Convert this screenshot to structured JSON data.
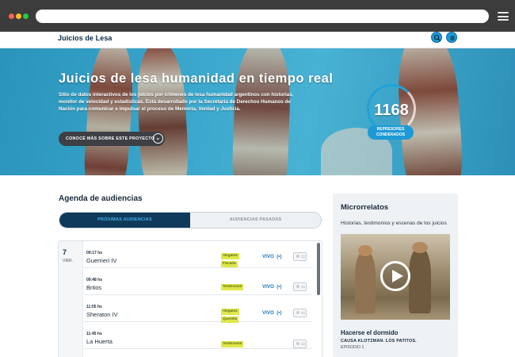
{
  "site": {
    "brand": "Juicios de Lesa"
  },
  "hero": {
    "title": "Juicios de lesa humanidad en tiempo real",
    "description": "Sitio de datos interactivos de los juicios por crímenes de lesa humanidad argentinos con historias, monitor de velocidad y estadísticas. Está desarrollado por la Secretaría de Derechos Humanos de Nación para comunicar e impulsar el proceso de Memoria, Verdad y Justicia.",
    "cta_label": "CONOCÉ MÁS SOBRE ESTE PROYECTO",
    "counter_value": "1168",
    "counter_label_line1": "REPRESORES",
    "counter_label_line2": "CONDENADOS"
  },
  "agenda": {
    "title": "Agenda de audiencias",
    "tabs": [
      "PRÓXIMAS AUDIENCIAS",
      "AUDIENCIAS PASADAS"
    ],
    "day_number": "7",
    "day_name": "VIER.",
    "rows": [
      {
        "time": "09:17 hs",
        "name": "Guerrieri IV",
        "tags": [
          "Alegatos",
          "Fiscalía"
        ],
        "live": "VIVO"
      },
      {
        "time": "09:48 hs",
        "name": "Britos",
        "tags": [
          "Testimonial"
        ],
        "live": "VIVO"
      },
      {
        "time": "11:05 hs",
        "name": "Sheraton IV",
        "tags": [
          "Alegatos",
          "Querella"
        ],
        "live": "VIVO"
      },
      {
        "time": "11:45 hs",
        "name": "La Huerta",
        "tags": [
          "Testimonial"
        ],
        "live": ""
      }
    ]
  },
  "micro": {
    "title": "Microrrelatos",
    "subtitle": "Historias, testimonios y escenas de los juicios",
    "story_title": "Hacerse el dormido",
    "story_cause": "CAUSA KLOTZMAN. LOS PATITOS.",
    "story_episode": "EPISODIO 1"
  },
  "colors": {
    "brand_blue": "#1d9ad6",
    "navy": "#103a5c",
    "tag_yellow": "#dfe84a",
    "live_blue": "#1d75b8"
  }
}
